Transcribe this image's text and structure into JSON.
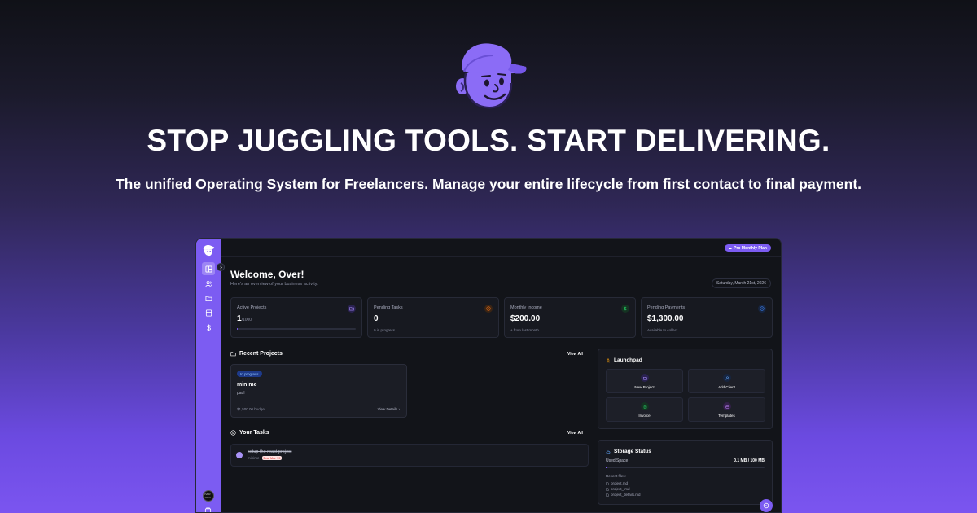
{
  "hero": {
    "headline": "STOP JUGGLING TOOLS. START DELIVERING.",
    "subline": "The unified Operating System for Freelancers. Manage your entire lifecycle from first contact to final payment.",
    "logo_icon": "freelancer-mascot-icon"
  },
  "colors": {
    "accent": "#7c5cf2",
    "background_dark": "#121419"
  },
  "app": {
    "plan_badge": "Pro Monthly Plan",
    "welcome_title": "Welcome, Over!",
    "welcome_sub": "Here's an overview of your business activity.",
    "date": "Saturday, March 21st, 2026",
    "sidebar": {
      "items": [
        {
          "icon": "dashboard-icon",
          "active": true
        },
        {
          "icon": "users-icon",
          "active": false
        },
        {
          "icon": "folder-icon",
          "active": false
        },
        {
          "icon": "document-icon",
          "active": false
        },
        {
          "icon": "dollar-icon",
          "active": false
        }
      ],
      "avatar_text": "OVER LOGO"
    },
    "stats": [
      {
        "label": "Active Projects",
        "value": "1",
        "suffix": "/1000",
        "note": "",
        "icon": "folder-icon",
        "progress": 0.001
      },
      {
        "label": "Pending Tasks",
        "value": "0",
        "suffix": "",
        "note": "0 in progress",
        "icon": "clock-icon"
      },
      {
        "label": "Monthly Income",
        "value": "$200.00",
        "suffix": "",
        "note": "+ from last month",
        "icon": "dollar-icon"
      },
      {
        "label": "Pending Payments",
        "value": "$1,300.00",
        "suffix": "",
        "note": "Available to collect",
        "icon": "clock-icon"
      }
    ],
    "recent_projects": {
      "title": "Recent Projects",
      "view_all": "View All",
      "items": [
        {
          "status": "In progress",
          "name": "minime",
          "client": "paul",
          "budget": "$1,500.00 budget",
          "details": "View Details"
        }
      ]
    },
    "tasks": {
      "title": "Your Tasks",
      "view_all": "View All",
      "items": [
        {
          "name": "setup the react project",
          "project": "minime",
          "due": "Due Mar 19"
        }
      ]
    },
    "launchpad": {
      "title": "Launchpad",
      "items": [
        {
          "label": "New Project",
          "icon": "folder-icon",
          "color": "#7c5cf2"
        },
        {
          "label": "Add Client",
          "icon": "users-icon",
          "color": "#3b82f6"
        },
        {
          "label": "Invoice",
          "icon": "receipt-icon",
          "color": "#22c55e"
        },
        {
          "label": "Templates",
          "icon": "template-icon",
          "color": "#a855f7"
        }
      ]
    },
    "storage": {
      "title": "Storage Status",
      "used_label": "Used Space",
      "used_value": "0.1 MB / 100 MB",
      "used_fraction": 0.001,
      "recent_label": "Recent files:",
      "files": [
        "project.md",
        "project_.md",
        "project_details.md"
      ]
    }
  }
}
